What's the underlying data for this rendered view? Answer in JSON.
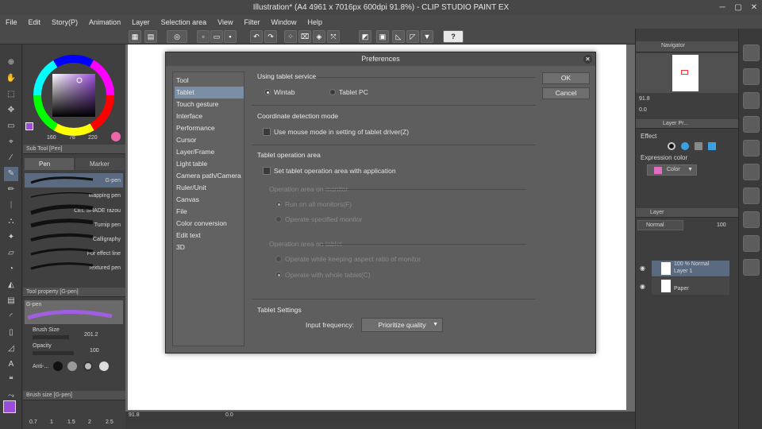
{
  "window": {
    "title": "Illustration* (A4 4961 x 7016px 600dpi 91.8%) - CLIP STUDIO PAINT EX"
  },
  "menu": [
    "File",
    "Edit",
    "Story(P)",
    "Animation",
    "Layer",
    "Selection area",
    "View",
    "Filter",
    "Window",
    "Help"
  ],
  "toolbar": {
    "help_label": "?"
  },
  "color": {
    "r": "160",
    "g": "78",
    "b": "220",
    "main": "#9b4edc"
  },
  "subtool": {
    "header": "Sub Tool [Pen]",
    "tab_pen": "Pen",
    "tab_marker": "Marker",
    "brushes": [
      "G-pen",
      "Mapping pen",
      "CEL SHADE razou",
      "Turnip pen",
      "Calligraphy",
      "For effect line",
      "Textured pen"
    ]
  },
  "toolprop": {
    "header": "Tool property [G-pen]",
    "name": "G-pen",
    "brush_size_label": "Brush Size",
    "brush_size": "201.2",
    "opacity_label": "Opacity",
    "opacity": "100",
    "aa_label": "Anti-..."
  },
  "brushsize": {
    "header": "Brush size [G-pen]",
    "values": [
      "0.7",
      "1",
      "1.5",
      "2",
      "2.5"
    ]
  },
  "status": {
    "zoom": "91.8",
    "angle": "0.0"
  },
  "dialog": {
    "title": "Preferences",
    "categories": [
      "Tool",
      "Tablet",
      "Touch gesture",
      "Interface",
      "Performance",
      "Cursor",
      "Layer/Frame",
      "Light table",
      "Camera path/Camera",
      "Ruler/Unit",
      "Canvas",
      "File",
      "Color conversion",
      "Edit text",
      "3D"
    ],
    "selected_category": "Tablet",
    "ok_label": "OK",
    "cancel_label": "Cancel",
    "using_tablet_service": "Using tablet service",
    "wintab": "Wintab",
    "tablet_pc": "Tablet PC",
    "coord_detection": "Coordinate detection mode",
    "mouse_mode": "Use mouse mode in setting of tablet driver(Z)",
    "tablet_op_area": "Tablet operation area",
    "set_area_with_app": "Set tablet operation area with application",
    "area_on_monitor": "Operation area on monitor",
    "run_all_monitors": "Run on all monitors(F)",
    "operate_specified": "Operate specified monitor",
    "area_on_tablet": "Operation area on tablet",
    "keep_aspect": "Operate while keeping aspect ratio of monitor",
    "whole_tablet": "Operate with whole tablet(C)",
    "tablet_settings": "Tablet Settings",
    "input_freq_label": "Input frequency:",
    "input_freq_value": "Prioritize quality"
  },
  "navigator": {
    "tab": "Navigator",
    "zoom": "91.8",
    "angle": "0.0"
  },
  "layerprop": {
    "tab": "Layer Pr...",
    "effect": "Effect",
    "expression_color": "Expression color",
    "color_value": "Color"
  },
  "layers": {
    "tab": "Layer",
    "blend": "Normal",
    "opacity": "100",
    "items": [
      {
        "line1": "100 % Normal",
        "line2": "Layer 1"
      },
      {
        "line1": "",
        "line2": "Paper"
      }
    ]
  }
}
